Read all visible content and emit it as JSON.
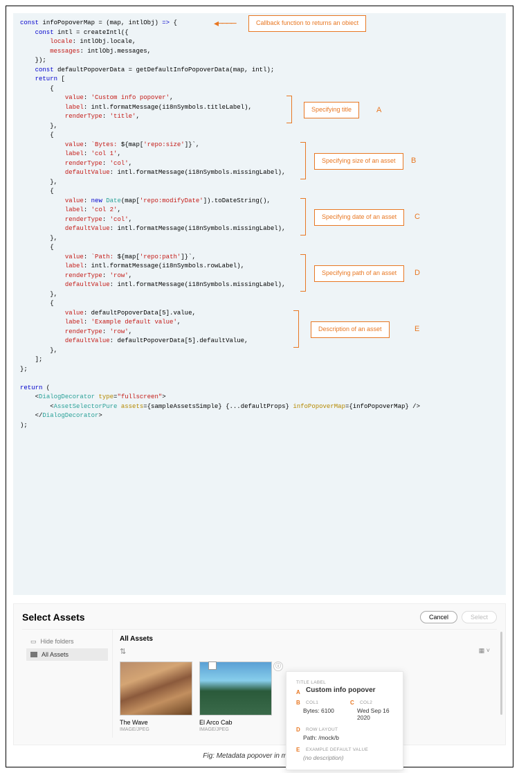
{
  "annotations": {
    "callback": "Callback function to returns an obiect",
    "a": {
      "text": "Specifying title",
      "letter": "A"
    },
    "b": {
      "text": "Specifying size of an asset",
      "letter": "B"
    },
    "c": {
      "text": "Specifying date of an asset",
      "letter": "C"
    },
    "d": {
      "text": "Specifying path of an asset",
      "letter": "D"
    },
    "e": {
      "text": "Description of an asset",
      "letter": "E"
    }
  },
  "code": {
    "l1a": "const",
    "l1b": " infoPopoverMap = (map, intlObj) ",
    "l1c": "=>",
    "l1d": " {",
    "l2a": "const",
    "l2b": " intl = createIntl({",
    "l3a": "locale",
    "l3b": ": intlObj.locale,",
    "l4a": "messages",
    "l4b": ": intlObj.messages,",
    "l5": "});",
    "l6a": "const",
    "l6b": " defaultPopoverData = getDefaultInfoPopoverData(map, intl);",
    "l7a": "return",
    "l7b": " [",
    "l8": "{",
    "v_title": "'Custom info popover'",
    "l_title": "intl.formatMessage(i18nSymbols.titleLabel)",
    "rt_title": "'title'",
    "v_size_a": "`Bytes: ",
    "v_size_b": "${map[",
    "v_size_c": "'repo:size'",
    "v_size_d": "]}`",
    "l_col1": "'col 1'",
    "rt_col": "'col'",
    "dv_miss": "intl.formatMessage(i18nSymbols.missingLabel)",
    "v_date_a": "new",
    "v_date_b": " Date",
    "v_date_c": "(map[",
    "v_date_d": "'repo:modifyDate'",
    "v_date_e": "]).toDateString()",
    "l_col2": "'col 2'",
    "v_path_a": "`Path: ",
    "v_path_b": "${map[",
    "v_path_c": "'repo:path'",
    "v_path_d": "]}`",
    "l_row": "intl.formatMessage(i18nSymbols.rowLabel)",
    "rt_row": "'row'",
    "v_def": "defaultPopoverData[5].value",
    "l_def": "'Example default value'",
    "dv_def": "defaultPopoverData[5].defaultValue",
    "prop_value": "value",
    "prop_label": "label",
    "prop_rt": "renderType",
    "prop_dv": "defaultValue",
    "close_obj": "},",
    "close_arr": "];",
    "close_fn": "};",
    "ret": "return",
    "ret2": " (",
    "jsx1a": "DialogDecorator",
    "jsx1b": "type",
    "jsx1c": "\"fullscreen\"",
    "jsx2a": "AssetSelectorPure",
    "jsx2b": "assets",
    "jsx2c": "{sampleAssetsSimple}",
    "jsx2d": "{...defaultProps}",
    "jsx2e": "infoPopoverMap",
    "jsx2f": "{infoPopoverMap}",
    "jsx3": "DialogDecorator",
    "close_ret": ");"
  },
  "ui": {
    "title": "Select Assets",
    "cancel": "Cancel",
    "select": "Select",
    "hide": "Hide folders",
    "all": "All Assets",
    "allHdr": "All Assets",
    "card1_t": "The Wave",
    "card1_s": "IMAGE/JPEG",
    "card2_t": "El Arco Cab",
    "card2_s": "IMAGE/JPEG",
    "pop": {
      "title_lbl": "TITLE LABEL",
      "title_val": "Custom info popover",
      "c1_lbl": "COL1",
      "c1_val": "Bytes: 6100",
      "c2_lbl": "COL2",
      "c2_val": "Wed Sep 16 2020",
      "row_lbl": "ROW LAYOUT",
      "row_val": "Path: /mock/b",
      "ex_lbl": "EXAMPLE DEFAULT VALUE",
      "ex_val": "(no description)"
    },
    "letters": {
      "a": "A",
      "b": "B",
      "c": "C",
      "d": "D",
      "e": "E"
    }
  },
  "caption": "Fig: Metadata popover in modal view"
}
